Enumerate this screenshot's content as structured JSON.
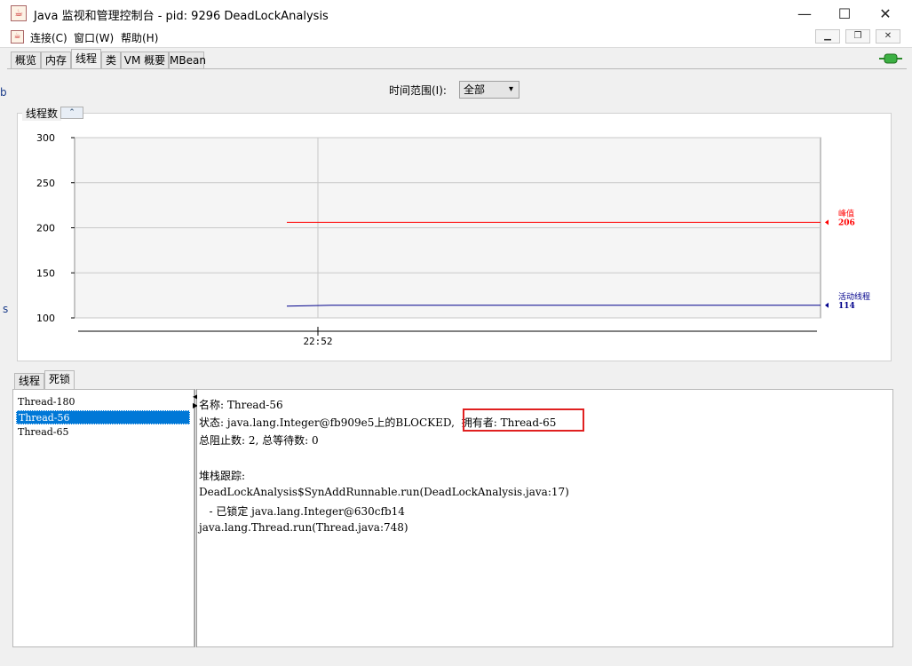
{
  "window": {
    "title": "Java 监视和管理控制台 - pid: 9296 DeadLockAnalysis",
    "app_icon_glyph": "☕",
    "controls": {
      "minimize": "—",
      "maximize": "☐",
      "close": "✕"
    }
  },
  "menu": {
    "items": [
      "连接(C)",
      "窗口(W)",
      "帮助(H)"
    ],
    "inner_controls": {
      "minimize": "▁",
      "restore": "❐",
      "close": "✕"
    }
  },
  "tabs": [
    {
      "label": "概览",
      "active": false
    },
    {
      "label": "内存",
      "active": false
    },
    {
      "label": "线程",
      "active": true
    },
    {
      "label": "类",
      "active": false
    },
    {
      "label": "VM 概要",
      "active": false
    },
    {
      "label": "MBean",
      "active": false
    }
  ],
  "time_range": {
    "label": "时间范围(I):",
    "value": "全部"
  },
  "chart_section": {
    "legend": "线程数",
    "collapse_glyph": "⌃"
  },
  "chart_data": {
    "type": "line",
    "title": "线程数",
    "ylim": [
      100,
      300
    ],
    "yticks": [
      "300",
      "250",
      "200",
      "150",
      "100"
    ],
    "x_tick": "22:52",
    "series": [
      {
        "name": "峰值",
        "current": "206",
        "color": "#ff0000",
        "values": [
          206,
          206
        ]
      },
      {
        "name": "活动线程",
        "current": "114",
        "color": "#00008b",
        "values": [
          113,
          114
        ]
      }
    ]
  },
  "subtabs": [
    {
      "label": "线程",
      "active": false
    },
    {
      "label": "死锁",
      "active": true
    }
  ],
  "thread_list": [
    {
      "label": "Thread-180",
      "selected": false
    },
    {
      "label": "Thread-56",
      "selected": true
    },
    {
      "label": "Thread-65",
      "selected": false
    }
  ],
  "details": {
    "name_line": "名称: Thread-56",
    "state_line": "状态: java.lang.Integer@fb909e5上的BLOCKED,",
    "owner_text": "拥有者: Thread-65",
    "counts_line": "总阻止数: 2, 总等待数: 0",
    "stack_title": "堆栈跟踪:",
    "stack_lines": [
      "DeadLockAnalysis$SynAddRunnable.run(DeadLockAnalysis.java:17)",
      "   - 已锁定 java.lang.Integer@630cfb14",
      "java.lang.Thread.run(Thread.java:748)"
    ]
  },
  "colors": {
    "selection": "#0078d7",
    "highlight": "#e02020"
  }
}
